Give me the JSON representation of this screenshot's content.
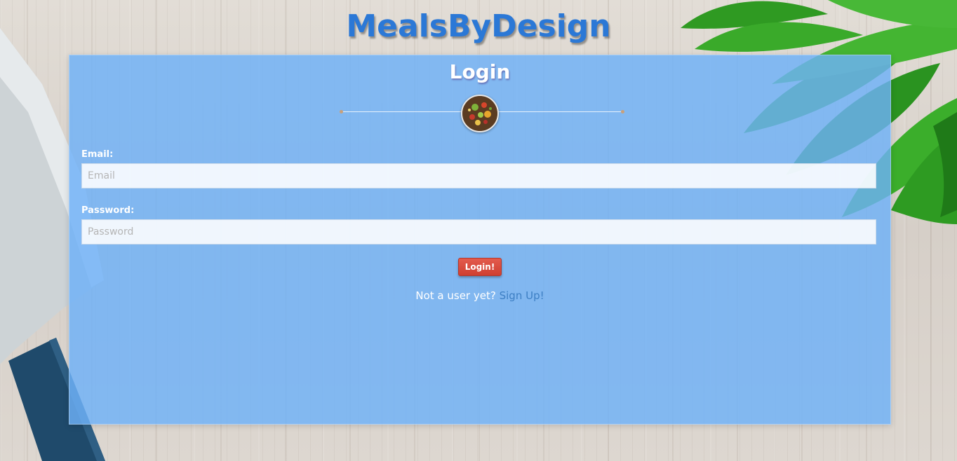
{
  "header": {
    "site_title": "MealsByDesign"
  },
  "login_panel": {
    "title": "Login",
    "email": {
      "label": "Email:",
      "placeholder": "Email",
      "value": ""
    },
    "password": {
      "label": "Password:",
      "placeholder": "Password",
      "value": ""
    },
    "submit_label": "Login!",
    "signup_prompt": "Not a user yet?",
    "signup_link": "Sign Up!"
  },
  "icons": {
    "avatar": "food-bowl-image",
    "background": "cutting-board-with-knife-and-herbs"
  },
  "colors": {
    "title": "#2b78d6",
    "panel": "#6eb1f8",
    "button": "#d9483a",
    "link": "#3d7fc4"
  }
}
